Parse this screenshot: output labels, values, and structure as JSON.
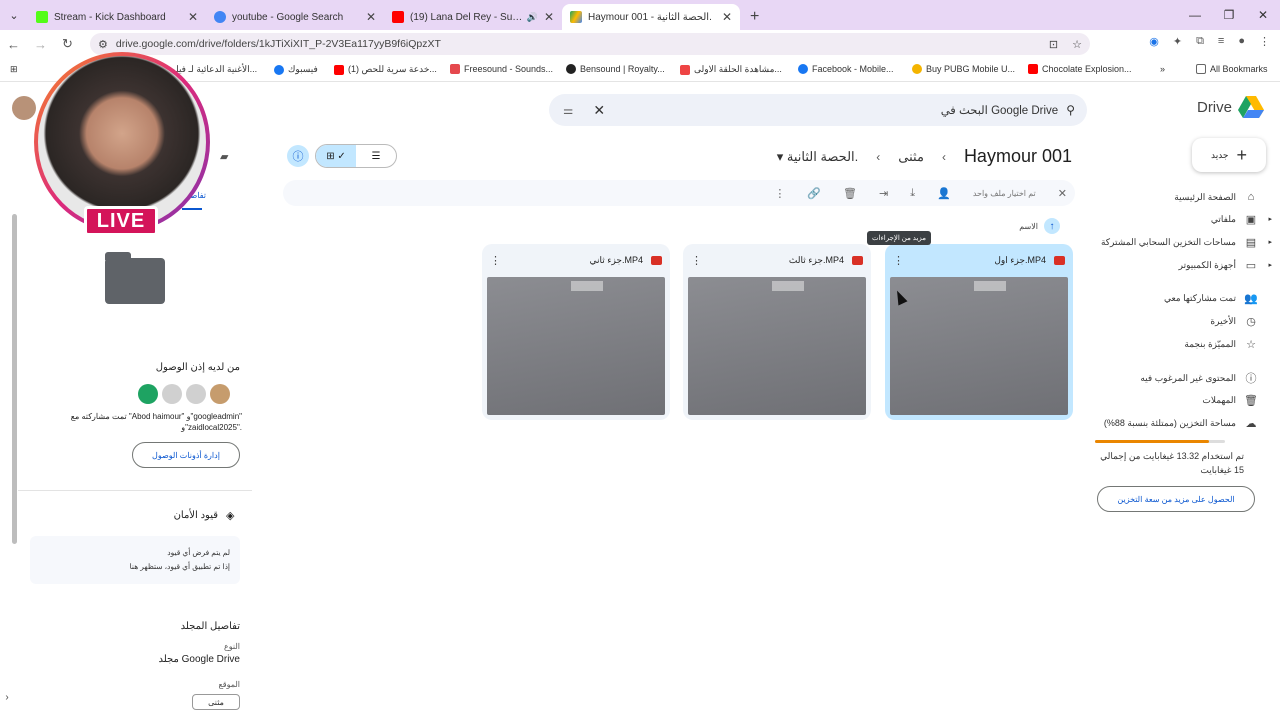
{
  "tabs": [
    {
      "title": "Stream - Kick Dashboard",
      "color": "#53fc18"
    },
    {
      "title": "youtube - Google Search",
      "color": "#4285f4"
    },
    {
      "title": "(19) Lana Del Rey - Summer",
      "color": "#ff0000"
    },
    {
      "title": "Haymour 001 - الحصة الثانية.",
      "color": "#1ea362"
    }
  ],
  "address": {
    "url": "drive.google.com/drive/folders/1kJTiXiXIT_P-2V3Ea117yyB9f6iQpzXT"
  },
  "bookmarks": [
    {
      "label": "الأغنية الدعائية لـ فيلم...",
      "color": "#999"
    },
    {
      "label": "فيسبوك",
      "color": "#1877f2"
    },
    {
      "label": "(1) خدعة سرية للحص...",
      "color": "#ff0000"
    },
    {
      "label": "Freesound - Sounds...",
      "color": "#e5484d"
    },
    {
      "label": "Bensound | Royalty...",
      "color": "#222"
    },
    {
      "label": "مشاهدة الحلقة الاولى...",
      "color": "#e44"
    },
    {
      "label": "Facebook - Mobile...",
      "color": "#1877f2"
    },
    {
      "label": "Buy PUBG Mobile U...",
      "color": "#f4b400"
    },
    {
      "label": "Chocolate Explosion...",
      "color": "#ff0000"
    },
    {
      "label": "All Bookmarks",
      "color": "#666"
    }
  ],
  "search": {
    "placeholder": "البحث في Google Drive"
  },
  "logo": "Drive",
  "new_label": "جديد",
  "nav": [
    {
      "label": "الصفحة الرئيسية",
      "icon": "⌂"
    },
    {
      "label": "ملفاتي",
      "icon": "▣"
    },
    {
      "label": "مساحات التخزين السحابي المشتركة",
      "icon": "▤"
    },
    {
      "label": "أجهزة الكمبيوتر",
      "icon": "▭"
    },
    {
      "label": "تمت مشاركتها معي",
      "icon": "👥"
    },
    {
      "label": "الأخيرة",
      "icon": "◷"
    },
    {
      "label": "المميّزة بنجمة",
      "icon": "☆"
    },
    {
      "label": "المحتوى غير المرغوب فيه",
      "icon": "ⓘ"
    },
    {
      "label": "المهملات",
      "icon": "🗑"
    },
    {
      "label": "مساحة التخزين (ممتلئة بنسبة 88%)",
      "icon": "☁"
    }
  ],
  "storage": {
    "used_fraction": 0.88,
    "text": "تم استخدام 13.32 غيغابايت من إجمالي 15 غيغابايت",
    "button": "الحصول على مزيد من سعة التخزين"
  },
  "breadcrumb": [
    "Haymour 001",
    "مثنى",
    "الحصة الثانية."
  ],
  "selection_bar": {
    "text": "تم اختيار ملف واحد"
  },
  "sort": {
    "label": "الاسم"
  },
  "tooltip": "مزيد من الإجراءات",
  "files": [
    {
      "name": "جزء ثاني.MP4"
    },
    {
      "name": "جزء ثالث.MP4"
    },
    {
      "name": "جزء اول.MP4"
    }
  ],
  "details": {
    "tab": "تفاصيل",
    "access_title": "من لديه إذن الوصول",
    "access_text": "تمت مشاركته مع \"Abod haimour\" و\"googleadmin\" و\"zaidlocal2025\".",
    "manage": "إدارة أذونات الوصول",
    "security_title": "قيود الأمان",
    "security_line1": "لم يتم فرض أي قيود",
    "security_line2": "إذا تم تطبيق أي قيود، ستظهر هنا",
    "folder_title": "تفاصيل المجلد",
    "type_label": "النوع",
    "type_value": "مجلد Google Drive",
    "loc_label": "الموقع",
    "loc_value": "مثنى"
  },
  "live": "LIVE"
}
